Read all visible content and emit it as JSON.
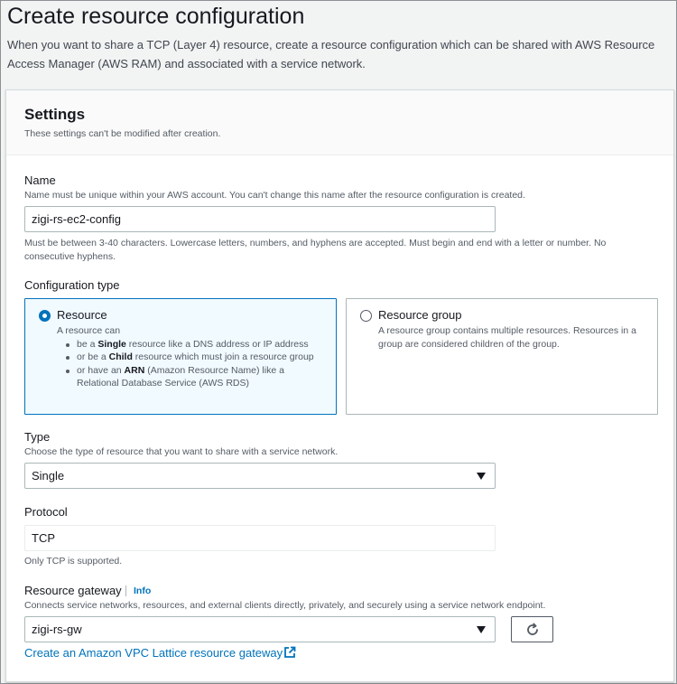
{
  "header": {
    "title": "Create resource configuration",
    "description": "When you want to share a TCP (Layer 4) resource, create a resource configuration which can be shared with AWS Resource Access Manager (AWS RAM) and associated with a service network."
  },
  "settings": {
    "title": "Settings",
    "subtitle": "These settings can't be modified after creation."
  },
  "name": {
    "label": "Name",
    "description": "Name must be unique within your AWS account. You can't change this name after the resource configuration is created.",
    "value": "zigi-rs-ec2-config",
    "constraint": "Must be between 3-40 characters. Lowercase letters, numbers, and hyphens are accepted. Must begin and end with a letter or number. No consecutive hyphens."
  },
  "configuration_type": {
    "label": "Configuration type",
    "selected": "Resource",
    "options": [
      {
        "title": "Resource",
        "intro": "A resource can",
        "bullets": [
          {
            "pre": "be a ",
            "bold": "Single",
            "post": " resource like a DNS address or IP address"
          },
          {
            "pre": "or be a ",
            "bold": "Child",
            "post": " resource which must join a resource group"
          },
          {
            "pre": "or have an ",
            "bold": "ARN",
            "post": " (Amazon Resource Name) like a Relational Database Service (AWS RDS)"
          }
        ]
      },
      {
        "title": "Resource group",
        "description": "A resource group contains multiple resources. Resources in a group are considered children of the group."
      }
    ]
  },
  "type": {
    "label": "Type",
    "description": "Choose the type of resource that you want to share with a service network.",
    "value": "Single"
  },
  "protocol": {
    "label": "Protocol",
    "value": "TCP",
    "hint": "Only TCP is supported."
  },
  "gateway": {
    "label": "Resource gateway",
    "info": "Info",
    "description": "Connects service networks, resources, and external clients directly, privately, and securely using a service network endpoint.",
    "value": "zigi-rs-gw",
    "create_link": "Create an Amazon VPC Lattice resource gateway"
  },
  "colors": {
    "accent": "#0073bb",
    "selected_tile_bg": "#f1faff"
  }
}
